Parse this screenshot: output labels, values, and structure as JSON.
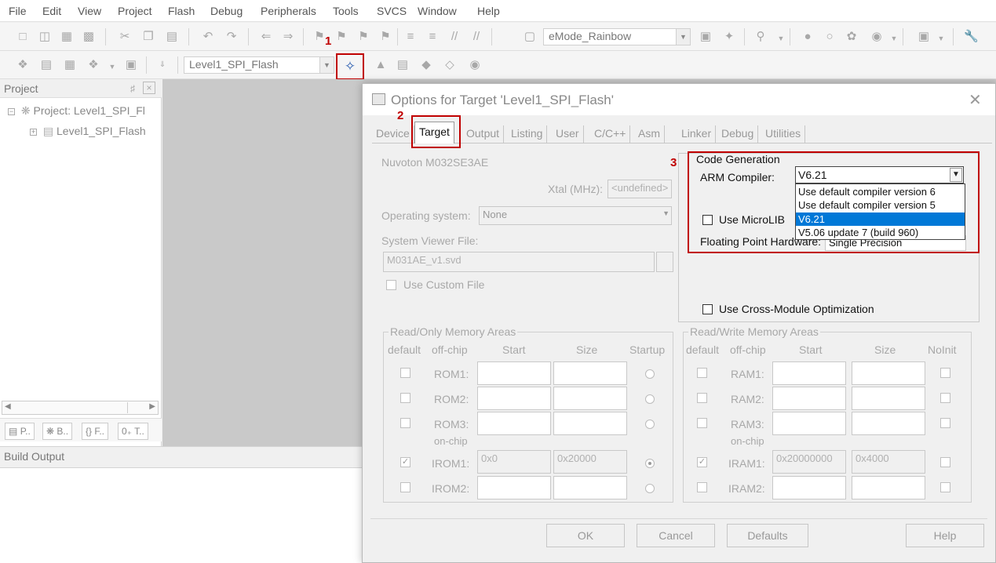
{
  "menu": [
    "File",
    "Edit",
    "View",
    "Project",
    "Flash",
    "Debug",
    "Peripherals",
    "Tools",
    "SVCS",
    "Window",
    "Help"
  ],
  "toolbar1": {
    "theme_combo": "eMode_Rainbow"
  },
  "toolbar2": {
    "target_combo": "Level1_SPI_Flash"
  },
  "steps": {
    "one": "1",
    "two": "2",
    "three": "3"
  },
  "project_panel": {
    "title": "Project",
    "root": "Project: Level1_SPI_Fl",
    "child": "Level1_SPI_Flash",
    "tabs": [
      "P..",
      "B..",
      "{} F..",
      "0₊ T.."
    ]
  },
  "build_output": {
    "title": "Build Output"
  },
  "dialog": {
    "title": "Options for Target 'Level1_SPI_Flash'",
    "tabs": [
      "Device",
      "Target",
      "Output",
      "Listing",
      "User",
      "C/C++",
      "Asm",
      "Linker",
      "Debug",
      "Utilities"
    ],
    "device": "Nuvoton M032SE3AE",
    "xtal_label": "Xtal (MHz):",
    "xtal_value": "<undefined>",
    "os_label": "Operating system:",
    "os_value": "None",
    "svd_label": "System Viewer File:",
    "svd_value": "M031AE_v1.svd",
    "custom_file_label": "Use Custom File",
    "code_generation": {
      "title": "Code Generation",
      "arm_compiler_label": "ARM Compiler:",
      "arm_compiler_value": "V6.21",
      "options": [
        "Use default compiler version 6",
        "Use default compiler version 5",
        "V6.21",
        "V5.06 update 7 (build 960)"
      ],
      "selected_index": 2,
      "microlib_label": "Use MicroLIB",
      "fph_label": "Floating Point Hardware:",
      "fph_value": "Single Precision",
      "cross_module_label": "Use Cross-Module Optimization"
    },
    "ro_memory": {
      "title": "Read/Only Memory Areas",
      "headers": {
        "default": "default",
        "offchip": "off-chip",
        "start": "Start",
        "size": "Size",
        "startup": "Startup"
      },
      "onchip_label": "on-chip",
      "rows": [
        {
          "label": "ROM1:",
          "start": "",
          "size": "",
          "checked": false,
          "startup": false
        },
        {
          "label": "ROM2:",
          "start": "",
          "size": "",
          "checked": false,
          "startup": false
        },
        {
          "label": "ROM3:",
          "start": "",
          "size": "",
          "checked": false,
          "startup": false
        },
        {
          "label": "IROM1:",
          "start": "0x0",
          "size": "0x20000",
          "checked": true,
          "startup": true
        },
        {
          "label": "IROM2:",
          "start": "",
          "size": "",
          "checked": false,
          "startup": false
        }
      ]
    },
    "rw_memory": {
      "title": "Read/Write Memory Areas",
      "headers": {
        "default": "default",
        "offchip": "off-chip",
        "start": "Start",
        "size": "Size",
        "noinit": "NoInit"
      },
      "onchip_label": "on-chip",
      "rows": [
        {
          "label": "RAM1:",
          "start": "",
          "size": "",
          "checked": false
        },
        {
          "label": "RAM2:",
          "start": "",
          "size": "",
          "checked": false
        },
        {
          "label": "RAM3:",
          "start": "",
          "size": "",
          "checked": false
        },
        {
          "label": "IRAM1:",
          "start": "0x20000000",
          "size": "0x4000",
          "checked": true
        },
        {
          "label": "IRAM2:",
          "start": "",
          "size": "",
          "checked": false
        }
      ]
    },
    "buttons": {
      "ok": "OK",
      "cancel": "Cancel",
      "defaults": "Defaults",
      "help": "Help"
    }
  },
  "colors": {
    "accent_red": "#c00000",
    "selection_blue": "#0078d7"
  }
}
